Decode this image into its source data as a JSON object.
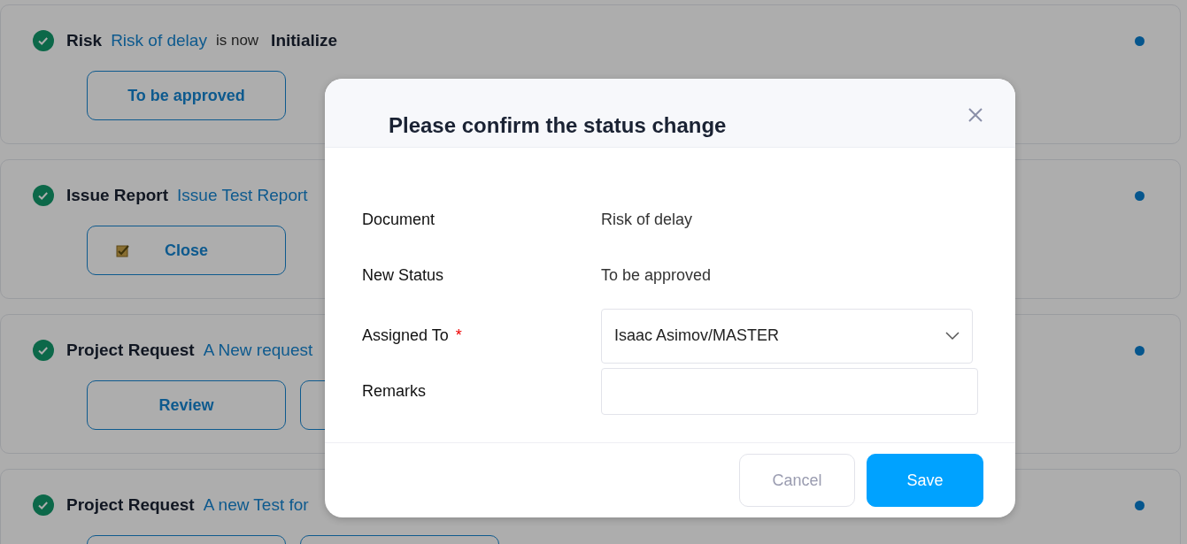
{
  "cards": [
    {
      "type": "Risk",
      "link": "Risk of delay",
      "connector": "is now",
      "status": "Initialize",
      "done": true,
      "unread": true,
      "actions": [
        {
          "kind": "labeled",
          "label": "To be approved",
          "icon": false
        }
      ]
    },
    {
      "type": "Issue Report",
      "link": "Issue Test Report",
      "done": true,
      "unread": true,
      "actions": [
        {
          "kind": "labeled",
          "label": "Close",
          "icon": true
        }
      ]
    },
    {
      "type": "Project Request",
      "link": "A New request",
      "done": true,
      "unread": true,
      "actions": [
        {
          "kind": "labeled",
          "label": "Review",
          "icon": false
        },
        {
          "kind": "covered"
        }
      ]
    },
    {
      "type": "Project Request",
      "link": "A new Test for",
      "done": true,
      "unread": true,
      "actions": [
        {
          "kind": "covered"
        },
        {
          "kind": "covered"
        }
      ]
    }
  ],
  "modal": {
    "title": "Please confirm the status change",
    "fields": [
      {
        "kind": "text",
        "label": "Document",
        "value": "Risk of delay"
      },
      {
        "kind": "text",
        "label": "New Status",
        "value": "To be approved"
      },
      {
        "kind": "select",
        "label": "Assigned To",
        "value": "Isaac Asimov/MASTER",
        "required_mark": "*"
      },
      {
        "kind": "input",
        "label": "Remarks"
      }
    ],
    "buttons": [
      {
        "label": "Cancel",
        "primary": false
      },
      {
        "label": "Save",
        "primary": true
      }
    ]
  }
}
